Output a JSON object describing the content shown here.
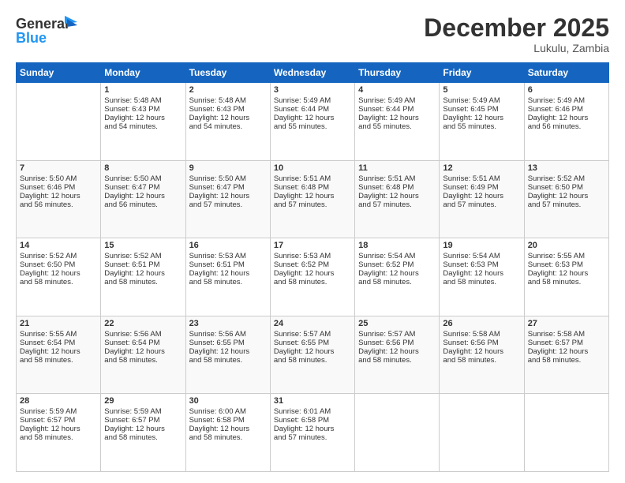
{
  "logo": {
    "line1": "General",
    "line2": "Blue"
  },
  "header": {
    "title": "December 2025",
    "location": "Lukulu, Zambia"
  },
  "days_of_week": [
    "Sunday",
    "Monday",
    "Tuesday",
    "Wednesday",
    "Thursday",
    "Friday",
    "Saturday"
  ],
  "weeks": [
    [
      {
        "day": "",
        "text": ""
      },
      {
        "day": "1",
        "text": "Sunrise: 5:48 AM\nSunset: 6:43 PM\nDaylight: 12 hours\nand 54 minutes."
      },
      {
        "day": "2",
        "text": "Sunrise: 5:48 AM\nSunset: 6:43 PM\nDaylight: 12 hours\nand 54 minutes."
      },
      {
        "day": "3",
        "text": "Sunrise: 5:49 AM\nSunset: 6:44 PM\nDaylight: 12 hours\nand 55 minutes."
      },
      {
        "day": "4",
        "text": "Sunrise: 5:49 AM\nSunset: 6:44 PM\nDaylight: 12 hours\nand 55 minutes."
      },
      {
        "day": "5",
        "text": "Sunrise: 5:49 AM\nSunset: 6:45 PM\nDaylight: 12 hours\nand 55 minutes."
      },
      {
        "day": "6",
        "text": "Sunrise: 5:49 AM\nSunset: 6:46 PM\nDaylight: 12 hours\nand 56 minutes."
      }
    ],
    [
      {
        "day": "7",
        "text": "Sunrise: 5:50 AM\nSunset: 6:46 PM\nDaylight: 12 hours\nand 56 minutes."
      },
      {
        "day": "8",
        "text": "Sunrise: 5:50 AM\nSunset: 6:47 PM\nDaylight: 12 hours\nand 56 minutes."
      },
      {
        "day": "9",
        "text": "Sunrise: 5:50 AM\nSunset: 6:47 PM\nDaylight: 12 hours\nand 57 minutes."
      },
      {
        "day": "10",
        "text": "Sunrise: 5:51 AM\nSunset: 6:48 PM\nDaylight: 12 hours\nand 57 minutes."
      },
      {
        "day": "11",
        "text": "Sunrise: 5:51 AM\nSunset: 6:48 PM\nDaylight: 12 hours\nand 57 minutes."
      },
      {
        "day": "12",
        "text": "Sunrise: 5:51 AM\nSunset: 6:49 PM\nDaylight: 12 hours\nand 57 minutes."
      },
      {
        "day": "13",
        "text": "Sunrise: 5:52 AM\nSunset: 6:50 PM\nDaylight: 12 hours\nand 57 minutes."
      }
    ],
    [
      {
        "day": "14",
        "text": "Sunrise: 5:52 AM\nSunset: 6:50 PM\nDaylight: 12 hours\nand 58 minutes."
      },
      {
        "day": "15",
        "text": "Sunrise: 5:52 AM\nSunset: 6:51 PM\nDaylight: 12 hours\nand 58 minutes."
      },
      {
        "day": "16",
        "text": "Sunrise: 5:53 AM\nSunset: 6:51 PM\nDaylight: 12 hours\nand 58 minutes."
      },
      {
        "day": "17",
        "text": "Sunrise: 5:53 AM\nSunset: 6:52 PM\nDaylight: 12 hours\nand 58 minutes."
      },
      {
        "day": "18",
        "text": "Sunrise: 5:54 AM\nSunset: 6:52 PM\nDaylight: 12 hours\nand 58 minutes."
      },
      {
        "day": "19",
        "text": "Sunrise: 5:54 AM\nSunset: 6:53 PM\nDaylight: 12 hours\nand 58 minutes."
      },
      {
        "day": "20",
        "text": "Sunrise: 5:55 AM\nSunset: 6:53 PM\nDaylight: 12 hours\nand 58 minutes."
      }
    ],
    [
      {
        "day": "21",
        "text": "Sunrise: 5:55 AM\nSunset: 6:54 PM\nDaylight: 12 hours\nand 58 minutes."
      },
      {
        "day": "22",
        "text": "Sunrise: 5:56 AM\nSunset: 6:54 PM\nDaylight: 12 hours\nand 58 minutes."
      },
      {
        "day": "23",
        "text": "Sunrise: 5:56 AM\nSunset: 6:55 PM\nDaylight: 12 hours\nand 58 minutes."
      },
      {
        "day": "24",
        "text": "Sunrise: 5:57 AM\nSunset: 6:55 PM\nDaylight: 12 hours\nand 58 minutes."
      },
      {
        "day": "25",
        "text": "Sunrise: 5:57 AM\nSunset: 6:56 PM\nDaylight: 12 hours\nand 58 minutes."
      },
      {
        "day": "26",
        "text": "Sunrise: 5:58 AM\nSunset: 6:56 PM\nDaylight: 12 hours\nand 58 minutes."
      },
      {
        "day": "27",
        "text": "Sunrise: 5:58 AM\nSunset: 6:57 PM\nDaylight: 12 hours\nand 58 minutes."
      }
    ],
    [
      {
        "day": "28",
        "text": "Sunrise: 5:59 AM\nSunset: 6:57 PM\nDaylight: 12 hours\nand 58 minutes."
      },
      {
        "day": "29",
        "text": "Sunrise: 5:59 AM\nSunset: 6:57 PM\nDaylight: 12 hours\nand 58 minutes."
      },
      {
        "day": "30",
        "text": "Sunrise: 6:00 AM\nSunset: 6:58 PM\nDaylight: 12 hours\nand 58 minutes."
      },
      {
        "day": "31",
        "text": "Sunrise: 6:01 AM\nSunset: 6:58 PM\nDaylight: 12 hours\nand 57 minutes."
      },
      {
        "day": "",
        "text": ""
      },
      {
        "day": "",
        "text": ""
      },
      {
        "day": "",
        "text": ""
      }
    ]
  ]
}
